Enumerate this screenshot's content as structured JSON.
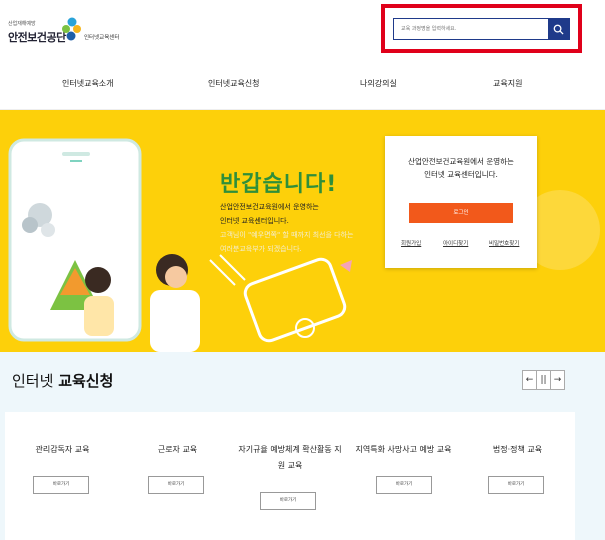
{
  "header": {
    "logo_small": "산업재해예방",
    "logo_main": "안전보건공단",
    "logo_sub": "인터넷교육센터",
    "search": {
      "placeholder": "교육 과정명을 입력하세요."
    }
  },
  "nav": {
    "items": [
      {
        "label": "인터넷교육소개"
      },
      {
        "label": "인터넷교육신청"
      },
      {
        "label": "나의강의실"
      },
      {
        "label": "교육지원"
      }
    ]
  },
  "hero": {
    "title": "반갑습니다!",
    "desc_line1": "산업안전보건교육원에서 운영하는",
    "desc_line2": "인터넷 교육센터입니다.",
    "desc_line3": "고객님이 \"예우면쪽\" 할 때까지 최선을 다하는",
    "desc_line4": "여러분교육부가 되겠습니다."
  },
  "login": {
    "title_line1": "산업안전보건교육원에서 운영하는",
    "title_line2": "인터넷 교육센터입니다.",
    "button_label": "로그인",
    "links": [
      {
        "label": "회원가입"
      },
      {
        "label": "아이디찾기"
      },
      {
        "label": "비밀번호찾기"
      }
    ]
  },
  "section": {
    "title_prefix": "인터넷",
    "title_bold": "교육신청",
    "controls": {
      "prev": "←",
      "pause": "||",
      "next": "→"
    },
    "courses": [
      {
        "name": "관리감독자 교육",
        "button": "바로가기"
      },
      {
        "name": "근로자 교육",
        "button": "바로가기"
      },
      {
        "name": "자기규율 예방체계 확산활동 지원 교육",
        "button": "바로가기"
      },
      {
        "name": "지역특화 사망사고 예방 교육",
        "button": "바로가기"
      },
      {
        "name": "법정·정책 교육",
        "button": "바로가기"
      }
    ]
  },
  "colors": {
    "hero_bg": "#fdd00a",
    "hero_title": "#2f8f3a",
    "login_btn": "#f2591b",
    "search_border": "#e0001a",
    "search_btn": "#1f3a8a"
  }
}
